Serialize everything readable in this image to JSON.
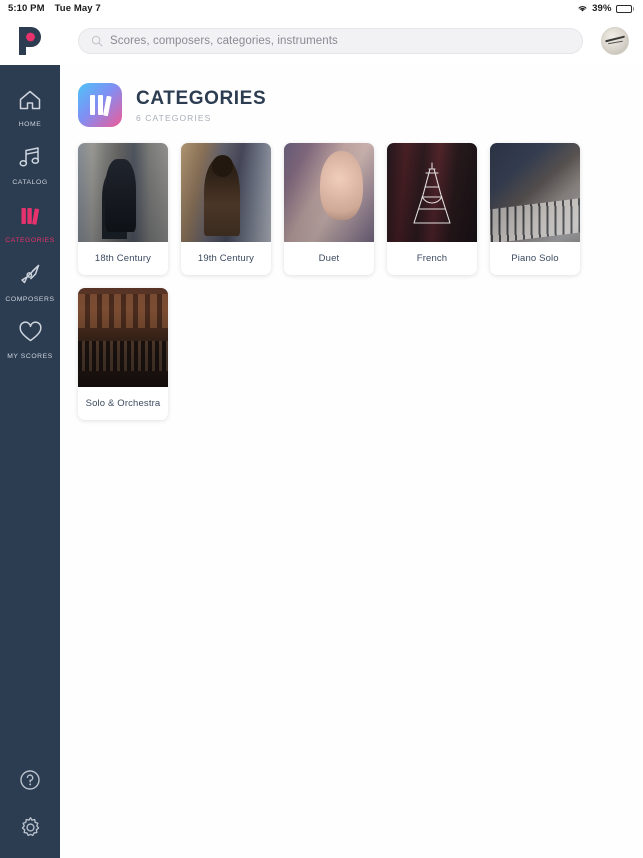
{
  "status_bar": {
    "time": "5:10 PM",
    "date": "Tue May 7",
    "battery_percent": "39%",
    "wifi_icon": "wifi-icon",
    "battery_icon": "battery-icon",
    "battery_level": 39
  },
  "topbar": {
    "logo_icon": "app-logo-p",
    "search": {
      "placeholder": "Scores, composers, categories, instruments",
      "value": "",
      "icon": "search-icon"
    },
    "avatar_label": "User avatar"
  },
  "sidebar": {
    "items": [
      {
        "label": "HOME",
        "icon": "home-icon",
        "active": false
      },
      {
        "label": "CATALOG",
        "icon": "music-note-icon",
        "active": false
      },
      {
        "label": "CATEGORIES",
        "icon": "books-icon",
        "active": true
      },
      {
        "label": "COMPOSERS",
        "icon": "fountain-pen-icon",
        "active": false
      },
      {
        "label": "MY SCORES",
        "icon": "heart-icon",
        "active": false
      }
    ],
    "bottom_items": [
      {
        "label": "Help",
        "icon": "help-circle-icon"
      },
      {
        "label": "Settings",
        "icon": "gear-icon"
      }
    ],
    "active_color": "#e8326d",
    "background_color": "#2c3c51"
  },
  "page": {
    "title": "CATEGORIES",
    "subtitle": "6 CATEGORIES",
    "header_icon": "books-icon",
    "count": 6
  },
  "categories": [
    {
      "label": "18th Century",
      "art": "art-bach",
      "overlay": "none"
    },
    {
      "label": "19th Century",
      "art": "art-chopin",
      "overlay": "none"
    },
    {
      "label": "Duet",
      "art": "art-duet",
      "overlay": "duet-badge-icon"
    },
    {
      "label": "French",
      "art": "art-french",
      "overlay": "eiffel-tower-icon"
    },
    {
      "label": "Piano Solo",
      "art": "art-piano",
      "overlay": "none"
    },
    {
      "label": "Solo & Orchestra",
      "art": "art-orch",
      "overlay": "none"
    }
  ],
  "colors": {
    "accent_pink": "#e8326d",
    "sidebar_navy": "#2c3c51",
    "text_dark": "#2c3c51",
    "muted": "#a9aeb8",
    "card_bg": "#ffffff",
    "page_bg": "#fefefe"
  }
}
